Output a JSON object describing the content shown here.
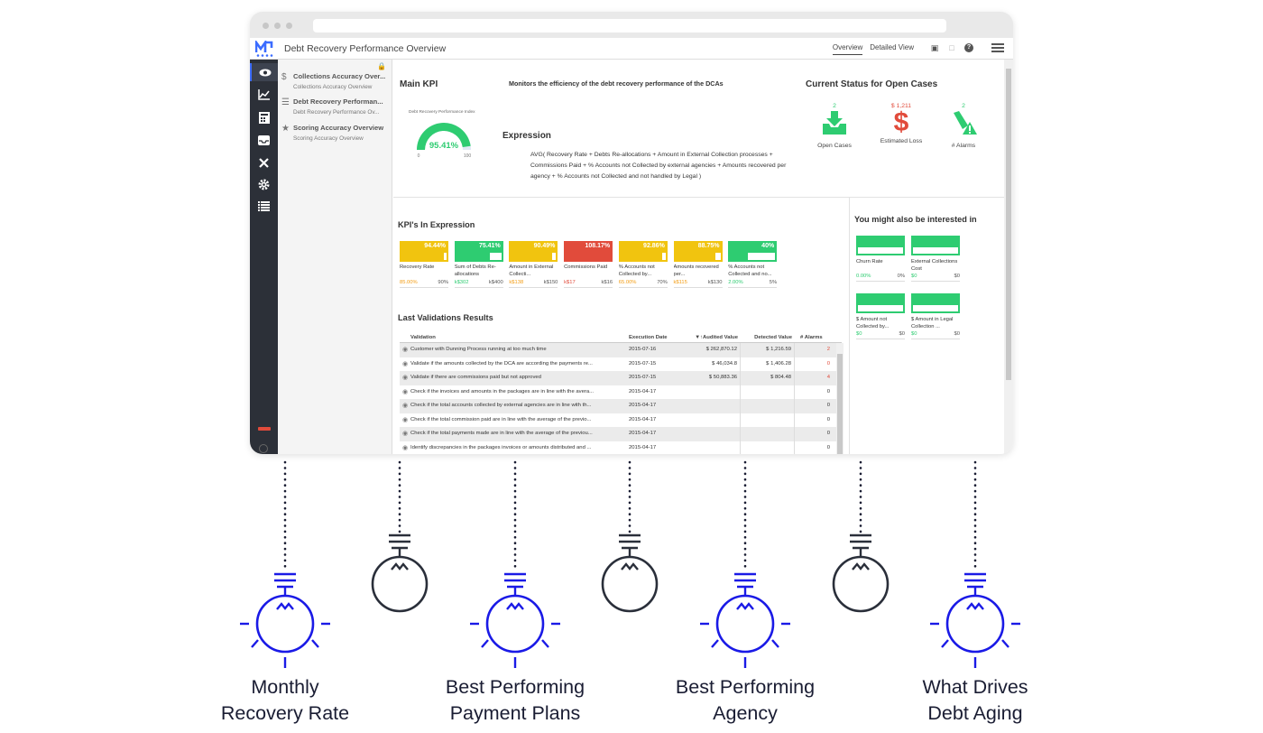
{
  "app": {
    "title": "Debt Recovery Performance Overview",
    "tabs": [
      {
        "label": "Overview",
        "active": true
      },
      {
        "label": "Detailed View",
        "active": false
      }
    ]
  },
  "sidebar_icons": [
    "eye-icon",
    "chart-icon",
    "calculator-icon",
    "inbox-icon",
    "tools-icon",
    "gear-icon",
    "list-icon"
  ],
  "nav": [
    {
      "title": "Collections Accuracy Over...",
      "subtitle": "Collections Accuracy Overview",
      "icon": "dollar-icon"
    },
    {
      "title": "Debt Recovery Performan...",
      "subtitle": "Debt Recovery Performance Ov...",
      "icon": "hand-icon"
    },
    {
      "title": "Scoring Accuracy Overview",
      "subtitle": "Scoring Accuracy Overview",
      "icon": "star-icon"
    }
  ],
  "main_kpi": {
    "heading": "Main KPI",
    "gauge_label": "Debt Recovery Performance Index",
    "value": "95.41%",
    "value_num": 95.41,
    "min": "0",
    "max": "100"
  },
  "description": "Monitors the efficiency of the debt recovery performance of the DCAs",
  "expression": {
    "heading": "Expression",
    "text": "AVG( Recovery Rate + Debts Re-allocations + Amount in External Collection processes + Commissions Paid  + % Accounts not Collected by external agencies + Amounts recovered per agency + % Accounts not Collected and not handled by Legal )"
  },
  "status": {
    "heading": "Current Status for Open Cases",
    "items": [
      {
        "count": "2",
        "label": "Open Cases",
        "color": "#2ecc71",
        "icon": "inbox-down-icon"
      },
      {
        "count": "$ 1,211",
        "label": "Estimated Loss",
        "color": "#e14b3b",
        "icon": "dollar-icon"
      },
      {
        "count": "2",
        "label": "# Alarms",
        "color": "#2ecc71",
        "icon": "bell-alert-icon"
      }
    ]
  },
  "kpis": {
    "heading": "KPI's In Expression",
    "items": [
      {
        "value": "94.44%",
        "fill": 0.944,
        "color": "#f1c40f",
        "name": "Recovery Rate",
        "current": "85.00%",
        "target": "90%",
        "current_color": "#f39c12"
      },
      {
        "value": "75.41%",
        "fill": 0.75,
        "color": "#2ecc71",
        "name": "Sum of Debts Re-allocations",
        "current": "k$302",
        "target": "k$400",
        "current_color": "#2ecc71"
      },
      {
        "value": "90.49%",
        "fill": 0.905,
        "color": "#f1c40f",
        "name": "Amount in External Collecti...",
        "current": "k$138",
        "target": "k$150",
        "current_color": "#f39c12"
      },
      {
        "value": "108.17%",
        "fill": 1.0,
        "color": "#e14b3b",
        "name": "Commissions Paid",
        "current": "k$17",
        "target": "k$16",
        "current_color": "#e14b3b"
      },
      {
        "value": "92.86%",
        "fill": 0.93,
        "color": "#f1c40f",
        "name": "% Accounts not Collected by...",
        "current": "65.00%",
        "target": "70%",
        "current_color": "#f39c12"
      },
      {
        "value": "88.75%",
        "fill": 0.89,
        "color": "#f1c40f",
        "name": "Amounts recovered per...",
        "current": "k$115",
        "target": "k$130",
        "current_color": "#f39c12"
      },
      {
        "value": "40%",
        "fill": 0.4,
        "color": "#2ecc71",
        "name": "% Accounts not Collected and no...",
        "current": "2.00%",
        "target": "5%",
        "current_color": "#2ecc71"
      }
    ]
  },
  "validations": {
    "heading": "Last Validations Results",
    "columns": {
      "validation": "Validation",
      "date": "Execution Date",
      "audited": "▼↑Audited Value",
      "detected": "Detected Value",
      "alarms": "# Alarms"
    },
    "rows": [
      {
        "text": "Customer with Dunning Process running at too much time",
        "date": "2015-07-16",
        "audited": "$ 262,870.12",
        "detected": "$ 1,216.59",
        "alarms": "2",
        "alarm_red": true
      },
      {
        "text": "Validate if the amounts collected by the DCA are according the payments re...",
        "date": "2015-07-15",
        "audited": "$ 46,034.8",
        "detected": "$ 1,406.28",
        "alarms": "0",
        "alarm_red": true
      },
      {
        "text": "Validate if there are commissions paid but not approved",
        "date": "2015-07-15",
        "audited": "$ 50,883.36",
        "detected": "$ 804.48",
        "alarms": "4",
        "alarm_red": true
      },
      {
        "text": "Check if the invoices and amounts in the packages are in line with the avera...",
        "date": "2015-04-17",
        "audited": "",
        "detected": "",
        "alarms": "0",
        "alarm_red": false
      },
      {
        "text": "Check if the total accounts collected by external agencies are in line with th...",
        "date": "2015-04-17",
        "audited": "",
        "detected": "",
        "alarms": "0",
        "alarm_red": false
      },
      {
        "text": "Check if the total commission paid are in line with the average of the previo...",
        "date": "2015-04-17",
        "audited": "",
        "detected": "",
        "alarms": "0",
        "alarm_red": false
      },
      {
        "text": "Check if the total payments made are in line with the average of the previou...",
        "date": "2015-04-17",
        "audited": "",
        "detected": "",
        "alarms": "0",
        "alarm_red": false
      },
      {
        "text": "Identify discrepancies in the packages invoices or amounts distributed and ...",
        "date": "2015-04-17",
        "audited": "",
        "detected": "",
        "alarms": "0",
        "alarm_red": false
      }
    ]
  },
  "related": {
    "heading": "You might also be interested in",
    "items": [
      {
        "name": "Churn Rate",
        "current": "0.00%",
        "target": "0%"
      },
      {
        "name": "External Collections Cost",
        "current": "$0",
        "target": "$0"
      },
      {
        "name": "$ Amount not Collected by...",
        "current": "$0",
        "target": "$0"
      },
      {
        "name": "$ Amount in Legal Collection ...",
        "current": "$0",
        "target": "$0"
      }
    ]
  },
  "captions": [
    {
      "line1": "Monthly",
      "line2": "Recovery Rate"
    },
    {
      "line1": "Best Performing",
      "line2": "Payment Plans"
    },
    {
      "line1": "Best Performing",
      "line2": "Agency"
    },
    {
      "line1": "What Drives",
      "line2": "Debt Aging"
    }
  ],
  "colors": {
    "bulb_lit": "#1a1ae6",
    "bulb_off": "#2a2f3a",
    "sidebar": "#2c3038",
    "green": "#2ecc71",
    "yellow": "#f1c40f",
    "red": "#e14b3b"
  }
}
